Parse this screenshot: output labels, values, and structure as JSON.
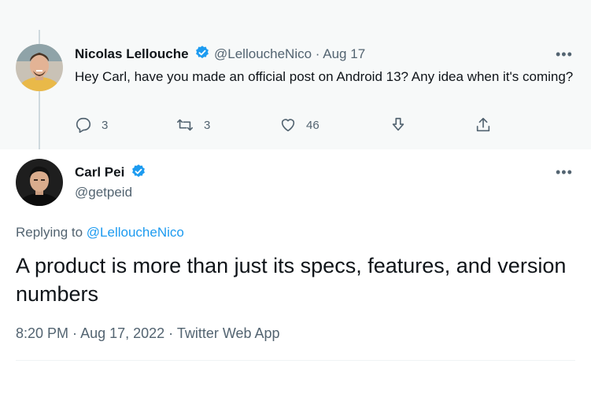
{
  "reply_tweet": {
    "author_name": "Nicolas Lellouche",
    "handle": "@LelloucheNico",
    "separator": "·",
    "date": "Aug 17",
    "text": "Hey Carl, have you made an official post on Android 13? Any idea when it's coming?",
    "replies_count": "3",
    "retweets_count": "3",
    "likes_count": "46"
  },
  "main_tweet": {
    "author_name": "Carl Pei",
    "handle": "@getpeid",
    "replying_prefix": "Replying to",
    "replying_handle": "@LelloucheNico",
    "text": "A product is more than just its specs, features, and version numbers",
    "time": "8:20 PM",
    "date": "Aug 17, 2022",
    "source": "Twitter Web App",
    "meta_separator": " · "
  },
  "more_label": "•••",
  "colors": {
    "accent": "#1d9bf0",
    "muted": "#536471",
    "text": "#0f1419",
    "highlight_bg": "#f7f9f9"
  },
  "icons": [
    "verified-badge-icon",
    "reply-icon",
    "retweet-icon",
    "like-icon",
    "bookmark-icon",
    "share-icon",
    "more-icon"
  ]
}
